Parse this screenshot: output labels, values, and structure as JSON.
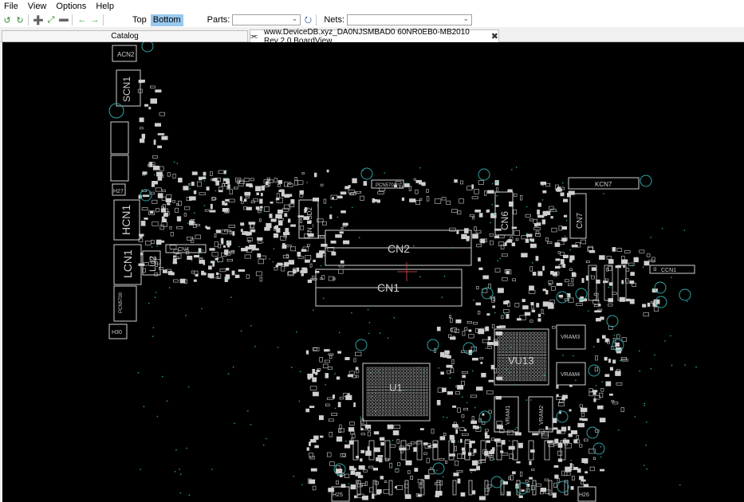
{
  "menu": [
    "File",
    "View",
    "Options",
    "Help"
  ],
  "toolbar": {
    "top_label": "Top",
    "bottom_label": "Bottom",
    "parts_label": "Parts:",
    "parts_value": "",
    "nets_label": "Nets:",
    "nets_value": ""
  },
  "tabs": {
    "catalog": "Catalog",
    "boardview": "www.DeviceDB.xyz_DA0NJSMBAD0 60NR0EB0-MB2010 Rev 2.0 BoardView"
  },
  "board_labels": {
    "acn2": "ACN2",
    "scn1": "SCN1",
    "hcn1": "HCN1",
    "lcn1": "LCN1",
    "lu2": "LU2",
    "cn2": "CN2",
    "cn1": "CN1",
    "cn_ssd2": "CN_SSD2",
    "cn4": "CN4",
    "cn6": "CN6",
    "cn7": "CN7",
    "kcn7": "KCN7",
    "pcn5701": "PCN5701",
    "vu13": "VU13",
    "u1": "U1",
    "vram1": "VRAM1",
    "vram2": "VRAM2",
    "vram3": "VRAM3",
    "vram4": "VRAM4",
    "h30": "H30",
    "h25": "H25",
    "h26": "H26",
    "h27": "H27",
    "pcn5700": "PCN5700",
    "ccn1": "CCN1"
  },
  "colors": {
    "board_bg": "#000000",
    "silkscreen": "#cfcfcf",
    "hole": "#2fa4a4",
    "active_layer": "#99c9ef"
  }
}
